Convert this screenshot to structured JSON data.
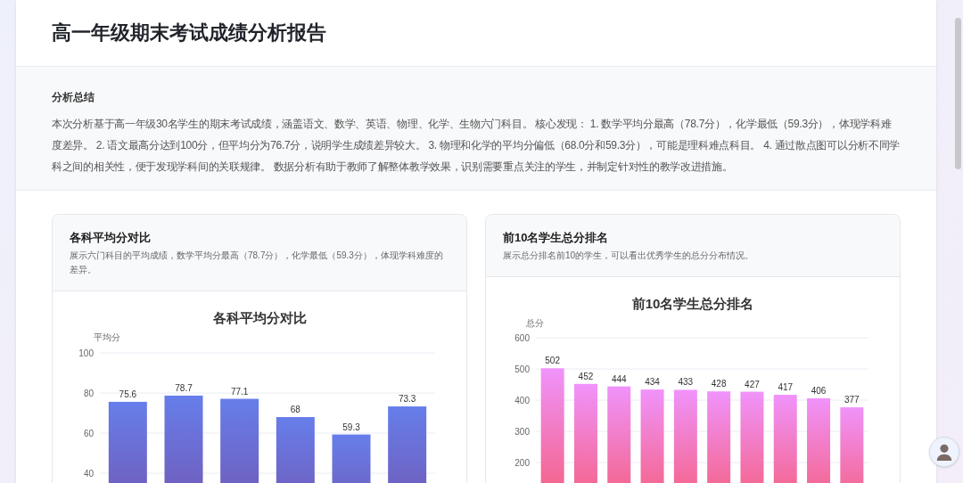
{
  "report": {
    "title": "高一年级期末考试成绩分析报告"
  },
  "summary": {
    "heading": "分析总结",
    "text": "本次分析基于高一年级30名学生的期末考试成绩，涵盖语文、数学、英语、物理、化学、生物六门科目。 核心发现： 1. 数学平均分最高（78.7分），化学最低（59.3分），体现学科难度差异。 2. 语文最高分达到100分，但平均分为76.7分，说明学生成绩差异较大。 3. 物理和化学的平均分偏低（68.0分和59.3分），可能是理科难点科目。 4. 通过散点图可以分析不同学科之间的相关性，便于发现学科间的关联规律。 数据分析有助于教师了解整体教学效果，识别需要重点关注的学生，并制定针对性的教学改进措施。"
  },
  "cards": [
    {
      "title": "各科平均分对比",
      "description": "展示六门科目的平均成绩，数学平均分最高（78.7分），化学最低（59.3分），体现学科难度的差异。",
      "chart_data": {
        "type": "bar",
        "title": "各科平均分对比",
        "ylabel": "平均分",
        "ylim": [
          0,
          100
        ],
        "yticks": [
          40,
          60,
          80,
          100
        ],
        "grid": true,
        "data_labels": true,
        "values": [
          75.6,
          78.7,
          77.1,
          68,
          59.3,
          73.3
        ]
      }
    },
    {
      "title": "前10名学生总分排名",
      "description": "展示总分排名前10的学生，可以看出优秀学生的总分分布情况。",
      "chart_data": {
        "type": "bar",
        "title": "前10名学生总分排名",
        "ylabel": "总分",
        "ylim": [
          0,
          600
        ],
        "yticks": [
          200,
          300,
          400,
          500,
          600
        ],
        "grid": true,
        "data_labels": true,
        "values": [
          502,
          452,
          444,
          434,
          433,
          428,
          427,
          417,
          406,
          377
        ]
      }
    }
  ]
}
